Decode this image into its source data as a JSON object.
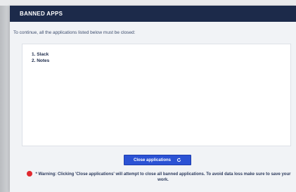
{
  "dialog": {
    "title": "BANNED APPS",
    "instruction": "To continue, all the applications listed below must be closed:",
    "apps": [
      {
        "label": "1. Slack"
      },
      {
        "label": "2. Notes"
      }
    ],
    "close_button_label": "Close applications",
    "close_button_icon": "refresh-icon",
    "warning_text": "* Warning: Clicking 'Close applications' will attempt to close all banned applications. To avoid data loss make sure to save your work.",
    "colors": {
      "title_bar": "#1c2a4a",
      "button": "#2b52d4",
      "warning_dot": "#e0292f"
    }
  }
}
